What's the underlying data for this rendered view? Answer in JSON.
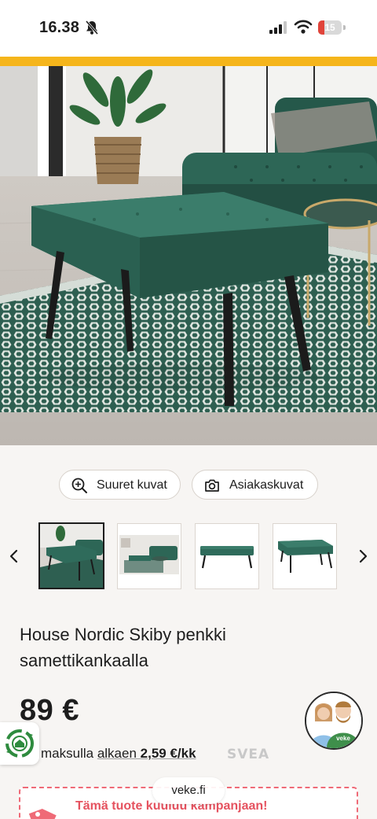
{
  "status_bar": {
    "time": "16.38",
    "battery": "15",
    "icons": [
      "bell-slash-icon",
      "signal-icon",
      "wifi-icon",
      "battery-icon"
    ]
  },
  "colors": {
    "accent": "#f5b51b",
    "velvet_green": "#2f6b5b",
    "campaign_red": "#e5525f"
  },
  "gallery": {
    "buttons": {
      "zoom_label": "Suuret kuvat",
      "zoom_icon": "zoom-in-icon",
      "customer_label": "Asiakaskuvat",
      "customer_icon": "camera-icon"
    },
    "thumbnails": [
      {
        "name": "bench-in-living-room",
        "selected": true
      },
      {
        "name": "bench-with-sofa-wide",
        "selected": false
      },
      {
        "name": "bench-front-view",
        "selected": false
      },
      {
        "name": "bench-angle-view",
        "selected": false
      }
    ],
    "prev_icon": "chevron-left-icon",
    "next_icon": "chevron-right-icon"
  },
  "product": {
    "title": "House Nordic Skiby penkki samettikankaalla",
    "price": "89 €"
  },
  "payment": {
    "prefix": "maksulla",
    "from_text": "alkaen",
    "amount": "2,59 €/kk",
    "provider_logo": "SVEA"
  },
  "campaign": {
    "text": "Tämä tuote kuuluu kampanjaan!",
    "tag_icon": "price-tag-icon"
  },
  "browser": {
    "url": "veke.fi"
  },
  "avatar_logo": "veke"
}
